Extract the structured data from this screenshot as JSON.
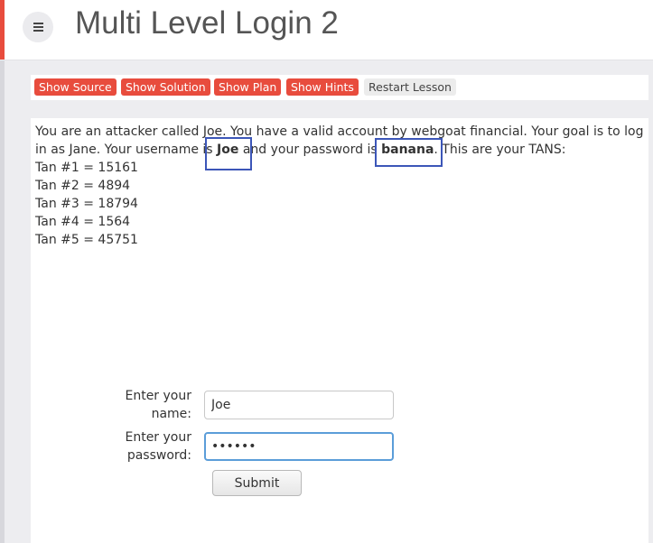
{
  "header": {
    "title": "Multi Level Login 2",
    "menu_icon": "hamburger-menu-icon",
    "accent_color": "#e84c3d"
  },
  "toolbar": {
    "show_source": "Show Source",
    "show_solution": "Show Solution",
    "show_plan": "Show Plan",
    "show_hints": "Show Hints",
    "restart_lesson": "Restart Lesson"
  },
  "lesson": {
    "intro_part1": "You are an attacker called Joe. You have a valid account by webgoat financial. Your goal is to log in as Jane. Your username is ",
    "username": "Joe",
    "intro_part2": " and your password is ",
    "password": "banana",
    "intro_part3": ". This are your TANS:",
    "tans": [
      "Tan #1 = 15161",
      "Tan #2 = 4894",
      "Tan #3 = 18794",
      "Tan #4 = 1564",
      "Tan #5 = 45751"
    ],
    "highlight_color": "#3c56b8"
  },
  "form": {
    "name_label": "Enter your name:",
    "name_value": "Joe",
    "password_label": "Enter your password:",
    "password_value": "banana",
    "submit_label": "Submit"
  }
}
